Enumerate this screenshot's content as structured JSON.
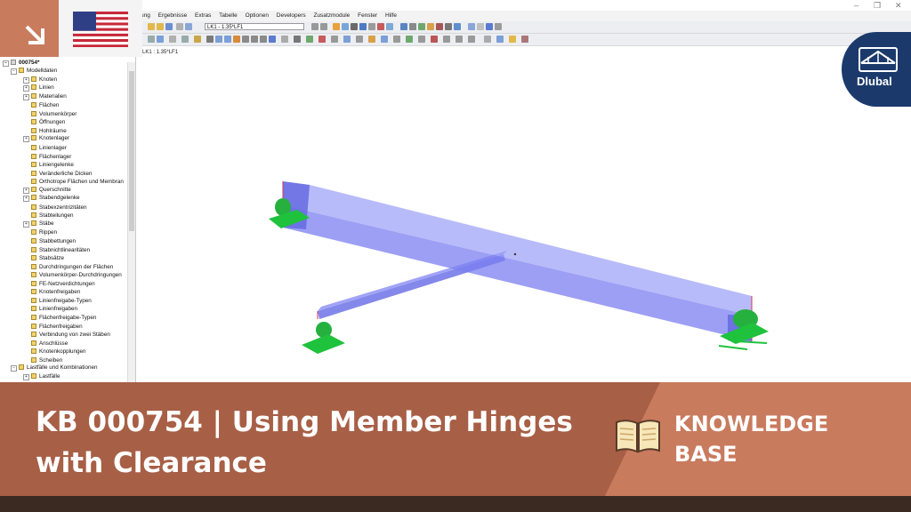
{
  "menu": [
    "ung",
    "Ergebnisse",
    "Extras",
    "Tabelle",
    "Optionen",
    "Developers",
    "Zusatzmodule",
    "Fenster",
    "Hilfe"
  ],
  "loadcase_select": "LK1 - 1.35*LF1",
  "viewport_label": "LK1 : 1.35*LF1",
  "tree": {
    "root": "000754*",
    "items": [
      {
        "label": "Modelldaten",
        "level": 1,
        "expander": "−"
      },
      {
        "label": "Knoten",
        "level": 2,
        "expander": "+"
      },
      {
        "label": "Linien",
        "level": 2,
        "expander": "+"
      },
      {
        "label": "Materialien",
        "level": 2,
        "expander": "+"
      },
      {
        "label": "Flächen",
        "level": 2,
        "expander": ""
      },
      {
        "label": "Volumenkörper",
        "level": 2,
        "expander": ""
      },
      {
        "label": "Öffnungen",
        "level": 2,
        "expander": ""
      },
      {
        "label": "Hohlräume",
        "level": 2,
        "expander": ""
      },
      {
        "label": "Knotenlager",
        "level": 2,
        "expander": "+"
      },
      {
        "label": "Linienlager",
        "level": 2,
        "expander": ""
      },
      {
        "label": "Flächenlager",
        "level": 2,
        "expander": ""
      },
      {
        "label": "Liniengelenke",
        "level": 2,
        "expander": ""
      },
      {
        "label": "Veränderliche Dicken",
        "level": 2,
        "expander": ""
      },
      {
        "label": "Orthotrope Flächen und Membran",
        "level": 2,
        "expander": ""
      },
      {
        "label": "Querschnitte",
        "level": 2,
        "expander": "+"
      },
      {
        "label": "Stabendgelenke",
        "level": 2,
        "expander": "+"
      },
      {
        "label": "Stabexzentrizitäten",
        "level": 2,
        "expander": ""
      },
      {
        "label": "Stabteilungen",
        "level": 2,
        "expander": ""
      },
      {
        "label": "Stäbe",
        "level": 2,
        "expander": "+"
      },
      {
        "label": "Rippen",
        "level": 2,
        "expander": ""
      },
      {
        "label": "Stabbettungen",
        "level": 2,
        "expander": ""
      },
      {
        "label": "Stabnichtlinearitäten",
        "level": 2,
        "expander": ""
      },
      {
        "label": "Stabsätze",
        "level": 2,
        "expander": ""
      },
      {
        "label": "Durchdringungen der Flächen",
        "level": 2,
        "expander": ""
      },
      {
        "label": "Volumenkörper-Durchdringungen",
        "level": 2,
        "expander": ""
      },
      {
        "label": "FE-Netzverdichtungen",
        "level": 2,
        "expander": ""
      },
      {
        "label": "Knotenfreigaben",
        "level": 2,
        "expander": ""
      },
      {
        "label": "Linienfreigabe-Typen",
        "level": 2,
        "expander": ""
      },
      {
        "label": "Linienfreigaben",
        "level": 2,
        "expander": ""
      },
      {
        "label": "Flächenfreigabe-Typen",
        "level": 2,
        "expander": ""
      },
      {
        "label": "Flächenfreigaben",
        "level": 2,
        "expander": ""
      },
      {
        "label": "Verbindung von zwei Stäben",
        "level": 2,
        "expander": ""
      },
      {
        "label": "Anschlüsse",
        "level": 2,
        "expander": ""
      },
      {
        "label": "Knotenkopplungen",
        "level": 2,
        "expander": ""
      },
      {
        "label": "Scheiben",
        "level": 2,
        "expander": ""
      },
      {
        "label": "Lastfälle und Kombinationen",
        "level": 1,
        "expander": "−"
      },
      {
        "label": "Lastfälle",
        "level": 2,
        "expander": "+"
      }
    ]
  },
  "logo_text": "Dlubal",
  "banner": {
    "title_line1": "KB 000754 | Using Member Hinges",
    "title_line2": "with Clearance",
    "label_line1": "KNOWLEDGE",
    "label_line2": "BASE"
  },
  "colors": {
    "banner_dark": "#a75f46",
    "banner_light": "#c97b5e",
    "beam_fill": "#7b7ff0",
    "support_green": "#19c23a",
    "logo_blue": "#1b3a6b"
  }
}
